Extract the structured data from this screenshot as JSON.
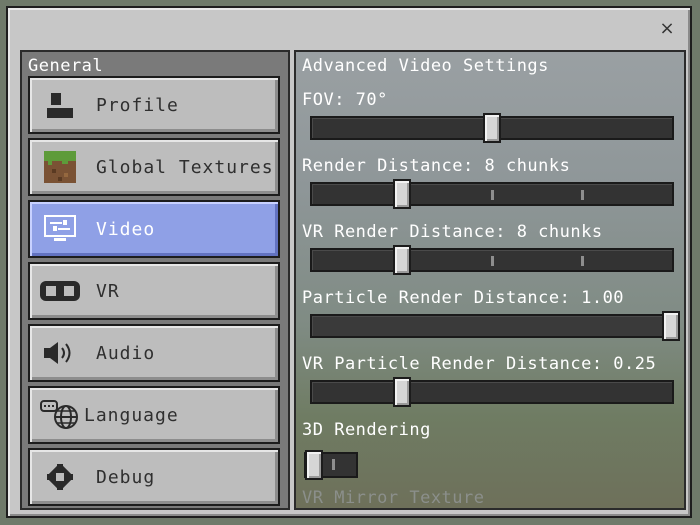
{
  "window": {
    "close_symbol": "×"
  },
  "sidebar": {
    "title": "General",
    "items": [
      {
        "label": "Profile",
        "icon": "profile-icon",
        "selected": false
      },
      {
        "label": "Global Textures",
        "icon": "grass-block-icon",
        "selected": false
      },
      {
        "label": "Video",
        "icon": "monitor-icon",
        "selected": true
      },
      {
        "label": "VR",
        "icon": "vr-headset-icon",
        "selected": false
      },
      {
        "label": "Audio",
        "icon": "speaker-icon",
        "selected": false
      },
      {
        "label": "Language",
        "icon": "language-globe-icon",
        "selected": false
      },
      {
        "label": "Debug",
        "icon": "gear-icon",
        "selected": false
      }
    ]
  },
  "video": {
    "heading": "Advanced Video Settings",
    "settings": [
      {
        "label": "FOV: 70°",
        "value_fraction": 0.5,
        "ticks": 0
      },
      {
        "label": "Render Distance: 8 chunks",
        "value_fraction": 0.25,
        "ticks": 3
      },
      {
        "label": "VR Render Distance: 8 chunks",
        "value_fraction": 0.25,
        "ticks": 3
      },
      {
        "label": "Particle Render Distance: 1.00",
        "value_fraction": 1.0,
        "ticks": 0
      },
      {
        "label": "VR Particle Render Distance: 0.25",
        "value_fraction": 0.25,
        "ticks": 0
      }
    ],
    "rendering_3d": {
      "label": "3D Rendering",
      "enabled": false
    },
    "vr_mirror_texture": {
      "label": "VR Mirror Texture"
    }
  },
  "colors": {
    "selected_item": "#8fa0e6",
    "panel_bg": "#c7c7c7"
  }
}
